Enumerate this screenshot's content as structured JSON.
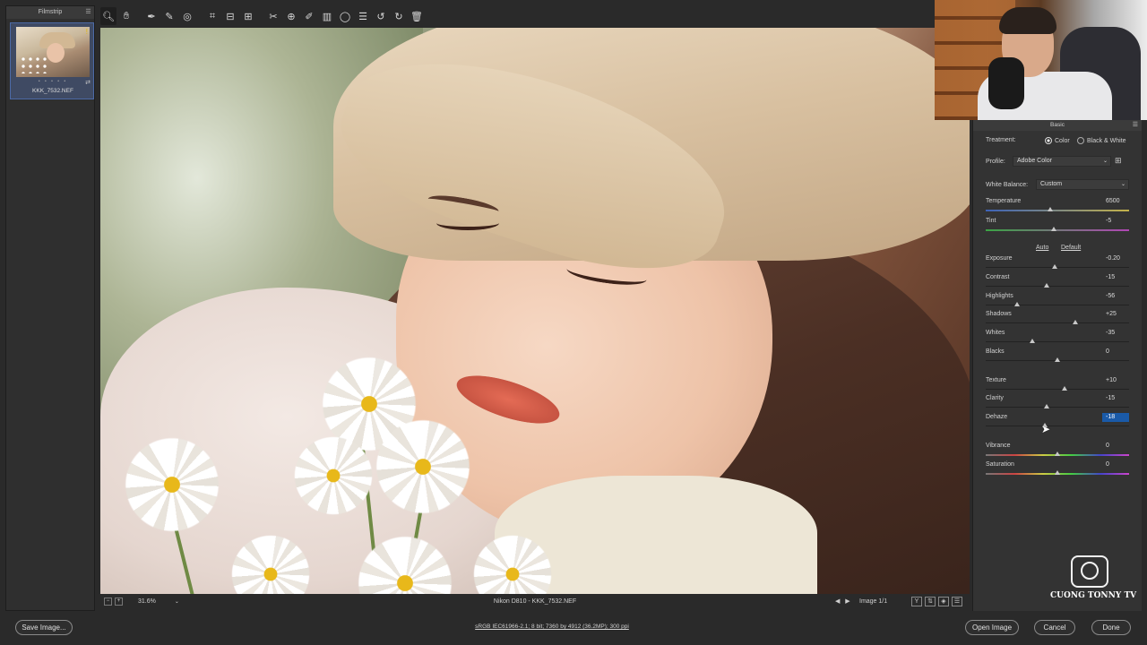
{
  "filmstrip": {
    "title": "Filmstrip",
    "thumbnail_name": "KKK_7532.NEF",
    "rating_dots": "• • • • •"
  },
  "toolbar": {
    "tools": [
      "zoom-icon",
      "hand-icon",
      "white-balance-icon",
      "color-sampler-icon",
      "targeted-adjustment-icon",
      "crop-icon",
      "straighten-icon",
      "transform-icon",
      "spot-removal-icon",
      "red-eye-icon",
      "adjustment-brush-icon",
      "graduated-filter-icon",
      "radial-filter-icon",
      "preferences-icon",
      "rotate-left-icon",
      "rotate-right-icon",
      "trash-icon"
    ]
  },
  "canvas": {
    "zoom": "31.6%",
    "camera_info": "Nikon D810  -  KKK_7532.NEF",
    "image_count": "Image 1/1"
  },
  "panel": {
    "title": "Basic",
    "treatment_label": "Treatment:",
    "treatment_color": "Color",
    "treatment_bw": "Black & White",
    "profile_label": "Profile:",
    "profile_value": "Adobe Color",
    "wb_label": "White Balance:",
    "wb_value": "Custom",
    "auto_label": "Auto",
    "default_label": "Default",
    "sliders": {
      "temperature": {
        "label": "Temperature",
        "value": "6500",
        "fraction": 0.45
      },
      "tint": {
        "label": "Tint",
        "value": "-5",
        "fraction": 0.475
      },
      "exposure": {
        "label": "Exposure",
        "value": "-0.20",
        "fraction": 0.48
      },
      "contrast": {
        "label": "Contrast",
        "value": "-15",
        "fraction": 0.425
      },
      "highlights": {
        "label": "Highlights",
        "value": "-56",
        "fraction": 0.22
      },
      "shadows": {
        "label": "Shadows",
        "value": "+25",
        "fraction": 0.625
      },
      "whites": {
        "label": "Whites",
        "value": "-35",
        "fraction": 0.325
      },
      "blacks": {
        "label": "Blacks",
        "value": "0",
        "fraction": 0.5
      },
      "texture": {
        "label": "Texture",
        "value": "+10",
        "fraction": 0.55
      },
      "clarity": {
        "label": "Clarity",
        "value": "-15",
        "fraction": 0.425
      },
      "dehaze": {
        "label": "Dehaze",
        "value": "-18",
        "fraction": 0.41
      },
      "vibrance": {
        "label": "Vibrance",
        "value": "0",
        "fraction": 0.5
      },
      "saturation": {
        "label": "Saturation",
        "value": "0",
        "fraction": 0.5
      }
    }
  },
  "watermark": {
    "text": "CUONG TONNY TV"
  },
  "bottombar": {
    "save_label": "Save Image...",
    "workflow": "sRGB IEC61966-2.1; 8 bit; 7360 by 4912 (36.2MP); 300 ppi",
    "open_label": "Open Image",
    "cancel_label": "Cancel",
    "done_label": "Done"
  }
}
